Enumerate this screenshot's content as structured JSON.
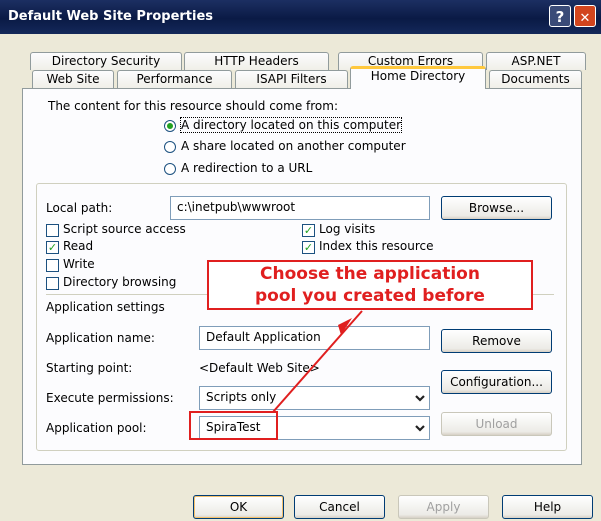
{
  "window": {
    "title": "Default Web Site Properties",
    "help_glyph": "?",
    "close_glyph": "✕"
  },
  "tabs_row1": [
    "Directory Security",
    "HTTP Headers",
    "Custom Errors",
    "ASP.NET"
  ],
  "tabs_row2": [
    "Web Site",
    "Performance",
    "ISAPI Filters",
    "Home Directory",
    "Documents"
  ],
  "content": {
    "heading": "The content for this resource should come from:",
    "options": [
      {
        "label": "A directory located on this computer",
        "selected": true
      },
      {
        "label": "A share located on another computer",
        "selected": false
      },
      {
        "label": "A redirection to a URL",
        "selected": false
      }
    ]
  },
  "local_path": {
    "label": "Local path:",
    "value": "c:\\inetpub\\wwwroot",
    "browse_label": "Browse..."
  },
  "checkboxes_left": [
    {
      "label": "Script source access",
      "checked": false
    },
    {
      "label": "Read",
      "checked": true
    },
    {
      "label": "Write",
      "checked": false
    },
    {
      "label": "Directory browsing",
      "checked": false
    }
  ],
  "checkboxes_right": [
    {
      "label": "Log visits",
      "checked": true
    },
    {
      "label": "Index this resource",
      "checked": true
    }
  ],
  "app_settings": {
    "section_label": "Application settings",
    "name_label": "Application name:",
    "name_value": "Default Application",
    "remove_label": "Remove",
    "start_label": "Starting point:",
    "start_value": "<Default Web Site>",
    "config_label": "Configuration...",
    "perm_label": "Execute permissions:",
    "perm_value": "Scripts only",
    "pool_label": "Application pool:",
    "pool_value": "SpiraTest",
    "unload_label": "Unload"
  },
  "annotation": {
    "line1": "Choose the application",
    "line2": "pool you created before"
  },
  "footer": {
    "ok": "OK",
    "cancel": "Cancel",
    "apply": "Apply",
    "help": "Help"
  }
}
